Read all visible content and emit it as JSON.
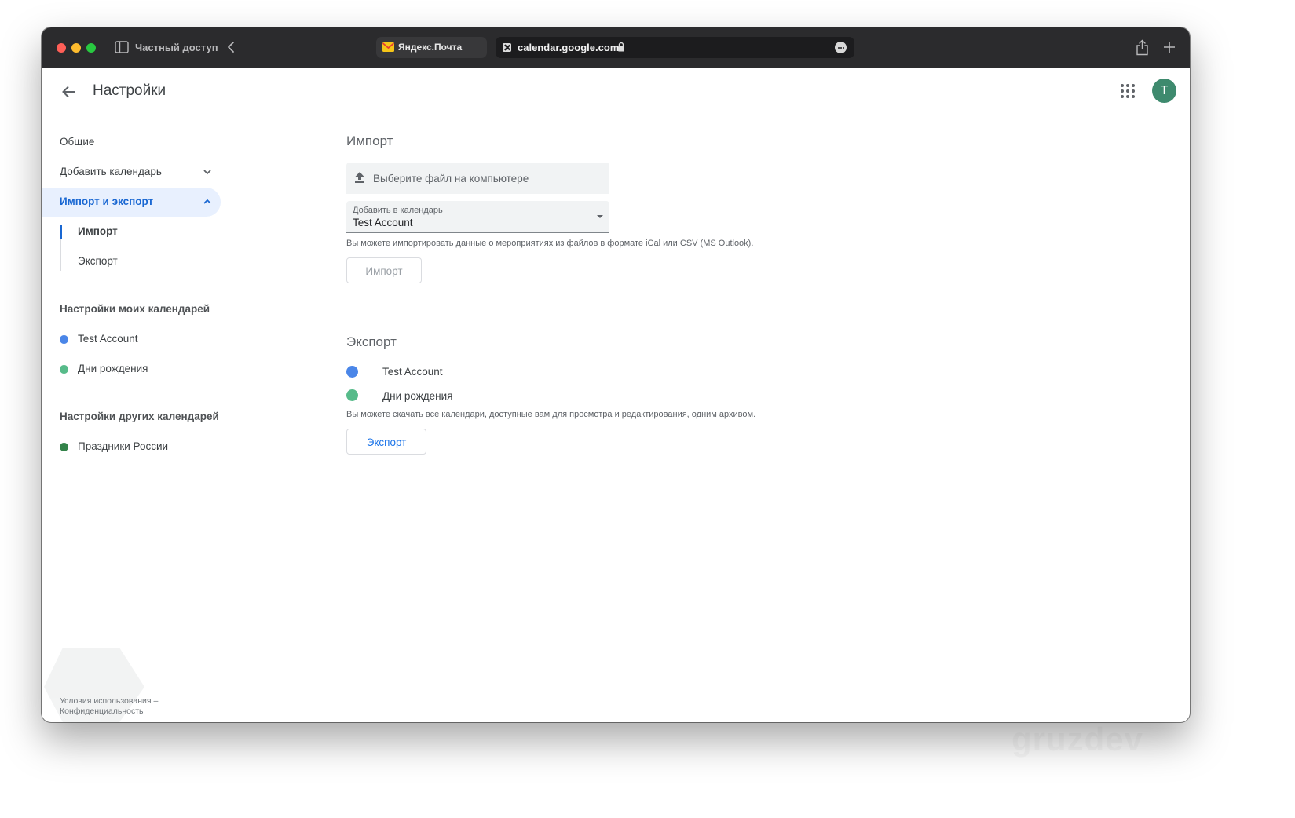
{
  "browser": {
    "private_label": "Частный доступ",
    "tab_mail_label": "Яндекс.Почта",
    "url": "calendar.google.com"
  },
  "header": {
    "title": "Настройки",
    "avatar_letter": "T"
  },
  "sidebar": {
    "general": "Общие",
    "add_calendar": "Добавить календарь",
    "import_export": "Импорт и экспорт",
    "sub_import": "Импорт",
    "sub_export": "Экспорт",
    "my_calendars_title": "Настройки моих календарей",
    "my_calendars": [
      {
        "name": "Test Account",
        "color": "#4a86e8"
      },
      {
        "name": "Дни рождения",
        "color": "#57bb8a"
      }
    ],
    "other_calendars_title": "Настройки других календарей",
    "other_calendars": [
      {
        "name": "Праздники России",
        "color": "#33834a"
      }
    ],
    "footer_terms": "Условия использования –",
    "footer_privacy": "Конфиденциальность"
  },
  "import": {
    "title": "Импорт",
    "file_picker_label": "Выберите файл на компьютере",
    "select_caption": "Добавить в календарь",
    "select_value": "Test Account",
    "hint": "Вы можете импортировать данные о мероприятиях из файлов в формате iCal или CSV (MS Outlook).",
    "button": "Импорт"
  },
  "export": {
    "title": "Экспорт",
    "calendars": [
      {
        "name": "Test Account",
        "color": "#4a86e8"
      },
      {
        "name": "Дни рождения",
        "color": "#57bb8a"
      }
    ],
    "hint": "Вы можете скачать все календари, доступные вам для просмотра и редактирования, одним архивом.",
    "button": "Экспорт"
  },
  "watermark": "gruzdev"
}
